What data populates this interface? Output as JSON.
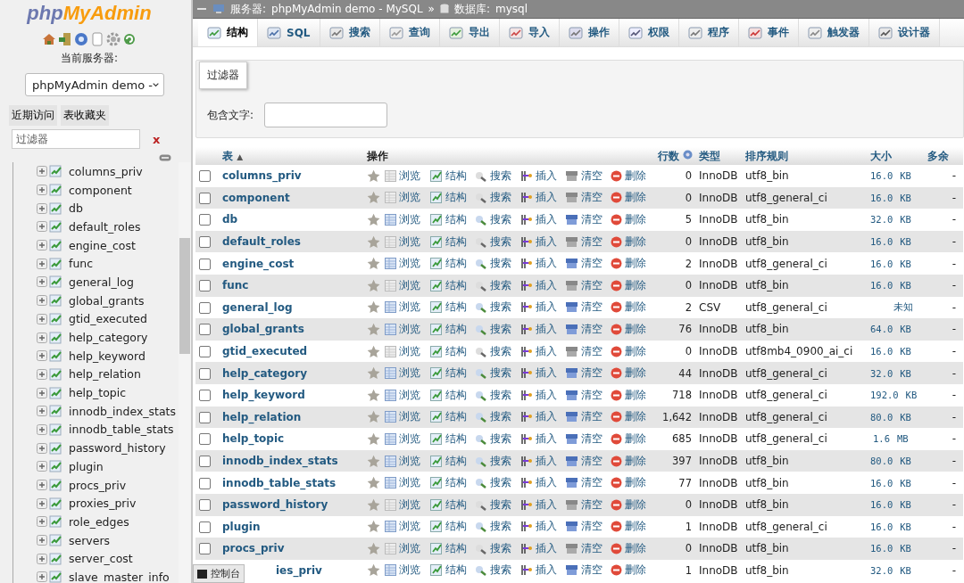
{
  "sidebar": {
    "logo": {
      "part1": "php",
      "part2": "MyAdmin"
    },
    "server_label": "当前服务器:",
    "server_select": {
      "value": "phpMyAdmin demo -"
    },
    "buttons": [
      "近期访问",
      "表收藏夹"
    ],
    "filter": {
      "placeholder": "过滤器",
      "clear": "x"
    },
    "tree": [
      {
        "label": "columns_priv"
      },
      {
        "label": "component"
      },
      {
        "label": "db"
      },
      {
        "label": "default_roles"
      },
      {
        "label": "engine_cost"
      },
      {
        "label": "func"
      },
      {
        "label": "general_log"
      },
      {
        "label": "global_grants"
      },
      {
        "label": "gtid_executed"
      },
      {
        "label": "help_category"
      },
      {
        "label": "help_keyword"
      },
      {
        "label": "help_relation"
      },
      {
        "label": "help_topic"
      },
      {
        "label": "innodb_index_stats"
      },
      {
        "label": "innodb_table_stats"
      },
      {
        "label": "password_history"
      },
      {
        "label": "plugin"
      },
      {
        "label": "procs_priv"
      },
      {
        "label": "proxies_priv"
      },
      {
        "label": "role_edges"
      },
      {
        "label": "servers"
      },
      {
        "label": "server_cost"
      },
      {
        "label": "slave_master_info"
      }
    ]
  },
  "breadcrumb": {
    "server": "服务器:",
    "server_name": "phpMyAdmin demo - MySQL",
    "separator": "»",
    "database": "数据库:",
    "database_name": "mysql"
  },
  "tabs": [
    {
      "label": "结构",
      "selected": true
    },
    {
      "label": "SQL",
      "selected": false
    },
    {
      "label": "搜索",
      "selected": false
    },
    {
      "label": "查询",
      "selected": false
    },
    {
      "label": "导出",
      "selected": false
    },
    {
      "label": "导入",
      "selected": false
    },
    {
      "label": "操作",
      "selected": false
    },
    {
      "label": "权限",
      "selected": false
    },
    {
      "label": "程序",
      "selected": false
    },
    {
      "label": "事件",
      "selected": false
    },
    {
      "label": "触发器",
      "selected": false
    },
    {
      "label": "设计器",
      "selected": false
    }
  ],
  "filter_panel": {
    "title": "过滤器",
    "label": "包含文字:"
  },
  "table": {
    "columns": {
      "name": "表",
      "sort": "▲",
      "actions": "操作",
      "rows": "行数",
      "type": "类型",
      "collation": "排序规则",
      "size": "大小",
      "overhead": "多余"
    },
    "rows": [
      {
        "checked": false,
        "name": "columns_priv",
        "empty": true,
        "actions": [
          "浏览",
          "结构",
          "搜索",
          "插入",
          "清空",
          "删除"
        ],
        "rows": "0",
        "type": "InnoDB",
        "collation": "utf8_bin",
        "size": "16.0",
        "unit": "KB",
        "overhead": "-"
      },
      {
        "checked": false,
        "name": "component",
        "empty": true,
        "actions": [
          "浏览",
          "结构",
          "搜索",
          "插入",
          "清空",
          "删除"
        ],
        "rows": "0",
        "type": "InnoDB",
        "collation": "utf8_general_ci",
        "size": "16.0",
        "unit": "KB",
        "overhead": "-"
      },
      {
        "checked": false,
        "name": "db",
        "empty": false,
        "actions": [
          "浏览",
          "结构",
          "搜索",
          "插入",
          "清空",
          "删除"
        ],
        "rows": "5",
        "type": "InnoDB",
        "collation": "utf8_bin",
        "size": "32.0",
        "unit": "KB",
        "overhead": "-"
      },
      {
        "checked": false,
        "name": "default_roles",
        "empty": true,
        "actions": [
          "浏览",
          "结构",
          "搜索",
          "插入",
          "清空",
          "删除"
        ],
        "rows": "0",
        "type": "InnoDB",
        "collation": "utf8_bin",
        "size": "16.0",
        "unit": "KB",
        "overhead": "-"
      },
      {
        "checked": false,
        "name": "engine_cost",
        "empty": false,
        "actions": [
          "浏览",
          "结构",
          "搜索",
          "插入",
          "清空",
          "删除"
        ],
        "rows": "2",
        "type": "InnoDB",
        "collation": "utf8_general_ci",
        "size": "16.0",
        "unit": "KB",
        "overhead": "-"
      },
      {
        "checked": false,
        "name": "func",
        "empty": true,
        "actions": [
          "浏览",
          "结构",
          "搜索",
          "插入",
          "清空",
          "删除"
        ],
        "rows": "0",
        "type": "InnoDB",
        "collation": "utf8_bin",
        "size": "16.0",
        "unit": "KB",
        "overhead": "-"
      },
      {
        "checked": false,
        "name": "general_log",
        "empty": false,
        "actions": [
          "浏览",
          "结构",
          "搜索",
          "插入",
          "清空",
          "删除"
        ],
        "rows": "2",
        "type": "CSV",
        "collation": "utf8_general_ci",
        "size": "未知",
        "unit": "",
        "overhead": "-"
      },
      {
        "checked": false,
        "name": "global_grants",
        "empty": false,
        "actions": [
          "浏览",
          "结构",
          "搜索",
          "插入",
          "清空",
          "删除"
        ],
        "rows": "76",
        "type": "InnoDB",
        "collation": "utf8_bin",
        "size": "64.0",
        "unit": "KB",
        "overhead": "-"
      },
      {
        "checked": false,
        "name": "gtid_executed",
        "empty": true,
        "actions": [
          "浏览",
          "结构",
          "搜索",
          "插入",
          "清空",
          "删除"
        ],
        "rows": "0",
        "type": "InnoDB",
        "collation": "utf8mb4_0900_ai_ci",
        "size": "16.0",
        "unit": "KB",
        "overhead": "-"
      },
      {
        "checked": false,
        "name": "help_category",
        "empty": false,
        "actions": [
          "浏览",
          "结构",
          "搜索",
          "插入",
          "清空",
          "删除"
        ],
        "rows": "44",
        "type": "InnoDB",
        "collation": "utf8_general_ci",
        "size": "32.0",
        "unit": "KB",
        "overhead": "-"
      },
      {
        "checked": false,
        "name": "help_keyword",
        "empty": false,
        "actions": [
          "浏览",
          "结构",
          "搜索",
          "插入",
          "清空",
          "删除"
        ],
        "rows": "718",
        "type": "InnoDB",
        "collation": "utf8_general_ci",
        "size": "192.0",
        "unit": "KB",
        "overhead": "-"
      },
      {
        "checked": false,
        "name": "help_relation",
        "empty": false,
        "actions": [
          "浏览",
          "结构",
          "搜索",
          "插入",
          "清空",
          "删除"
        ],
        "rows": "1,642",
        "type": "InnoDB",
        "collation": "utf8_general_ci",
        "size": "80.0",
        "unit": "KB",
        "overhead": "-"
      },
      {
        "checked": false,
        "name": "help_topic",
        "empty": false,
        "actions": [
          "浏览",
          "结构",
          "搜索",
          "插入",
          "清空",
          "删除"
        ],
        "rows": "685",
        "type": "InnoDB",
        "collation": "utf8_general_ci",
        "size": "1.6",
        "unit": "MB",
        "overhead": "-"
      },
      {
        "checked": false,
        "name": "innodb_index_stats",
        "empty": false,
        "actions": [
          "浏览",
          "结构",
          "搜索",
          "插入",
          "清空",
          "删除"
        ],
        "rows": "397",
        "type": "InnoDB",
        "collation": "utf8_bin",
        "size": "80.0",
        "unit": "KB",
        "overhead": "-"
      },
      {
        "checked": false,
        "name": "innodb_table_stats",
        "empty": false,
        "actions": [
          "浏览",
          "结构",
          "搜索",
          "插入",
          "清空",
          "删除"
        ],
        "rows": "77",
        "type": "InnoDB",
        "collation": "utf8_bin",
        "size": "16.0",
        "unit": "KB",
        "overhead": "-"
      },
      {
        "checked": false,
        "name": "password_history",
        "empty": true,
        "actions": [
          "浏览",
          "结构",
          "搜索",
          "插入",
          "清空",
          "删除"
        ],
        "rows": "0",
        "type": "InnoDB",
        "collation": "utf8_bin",
        "size": "16.0",
        "unit": "KB",
        "overhead": "-"
      },
      {
        "checked": false,
        "name": "plugin",
        "empty": false,
        "actions": [
          "浏览",
          "结构",
          "搜索",
          "插入",
          "清空",
          "删除"
        ],
        "rows": "1",
        "type": "InnoDB",
        "collation": "utf8_general_ci",
        "size": "16.0",
        "unit": "KB",
        "overhead": "-"
      },
      {
        "checked": false,
        "name": "procs_priv",
        "empty": true,
        "actions": [
          "浏览",
          "结构",
          "搜索",
          "插入",
          "清空",
          "删除"
        ],
        "rows": "0",
        "type": "InnoDB",
        "collation": "utf8_bin",
        "size": "16.0",
        "unit": "KB",
        "overhead": "-"
      },
      {
        "name": "ies_priv",
        "empty": false,
        "actions": [
          "浏览",
          "结构",
          "搜索",
          "插入",
          "清空",
          "删除"
        ],
        "rows": "1",
        "type": "InnoDB",
        "collation": "utf8_bin",
        "size": "32.0",
        "unit": "KB",
        "overhead": "-"
      }
    ]
  },
  "console": {
    "label": "控制台"
  }
}
